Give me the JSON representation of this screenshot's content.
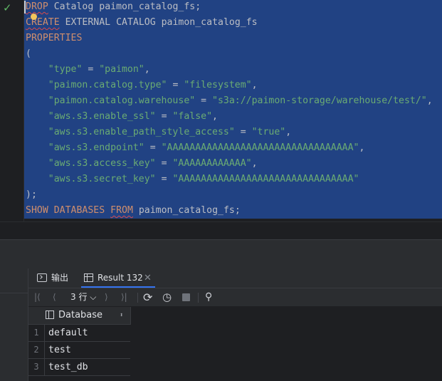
{
  "editor": {
    "line1": {
      "kw1": "DROP",
      "kw2": "Catalog",
      "name": "paimon_catalog_fs;"
    },
    "line2": {
      "kw1": "CREATE",
      "kw2": "EXTERNAL",
      "kw3": "CATALOG",
      "name": "paimon_catalog_fs"
    },
    "line3": {
      "kw": "PROPERTIES"
    },
    "line4": {
      "text": "("
    },
    "props": [
      {
        "key": "\"type\"",
        "value": "\"paimon\"",
        "end": ","
      },
      {
        "key": "\"paimon.catalog.type\"",
        "value": "\"filesystem\"",
        "end": ","
      },
      {
        "key": "\"paimon.catalog.warehouse\"",
        "value": "\"s3a://paimon-storage/warehouse/test/\"",
        "end": ","
      },
      {
        "key": "\"aws.s3.enable_ssl\"",
        "value": "\"false\"",
        "end": ","
      },
      {
        "key": "\"aws.s3.enable_path_style_access\"",
        "value": "\"true\"",
        "end": ","
      },
      {
        "key": "\"aws.s3.endpoint\"",
        "value": "\"AAAAAAAAAAAAAAAAAAAAAAAAAAAAAAAAA\"",
        "end": ","
      },
      {
        "key": "\"aws.s3.access_key\"",
        "value": "\"AAAAAAAAAAAA\"",
        "end": ","
      },
      {
        "key": "\"aws.s3.secret_key\"",
        "value": "\"AAAAAAAAAAAAAAAAAAAAAAAAAAAAAAA\"",
        "end": ""
      }
    ],
    "line13": {
      "text": ");"
    },
    "line14": {
      "kw1": "SHOW",
      "kw2": "DATABASES",
      "kw3": "FROM",
      "name": "paimon_catalog_fs;"
    },
    "colors": {
      "selection": "#214283",
      "keyword": "#cf8e6d",
      "string": "#6aab73"
    }
  },
  "results": {
    "tabs": {
      "output": "输出",
      "result": "Result 132"
    },
    "toolbar": {
      "rows": "3 行",
      "rows_caret": "⌵"
    },
    "icons": {
      "check": "✓",
      "close": "✕",
      "first": "|⟨",
      "prev": "⟨",
      "next": "⟩",
      "last": "⟩|",
      "refresh": "⟳",
      "clock": "◷",
      "pin": "⚲",
      "sort": "⬍"
    },
    "column": "Database",
    "rows": [
      {
        "num": "1",
        "value": "default"
      },
      {
        "num": "2",
        "value": "test"
      },
      {
        "num": "3",
        "value": "test_db"
      }
    ]
  }
}
